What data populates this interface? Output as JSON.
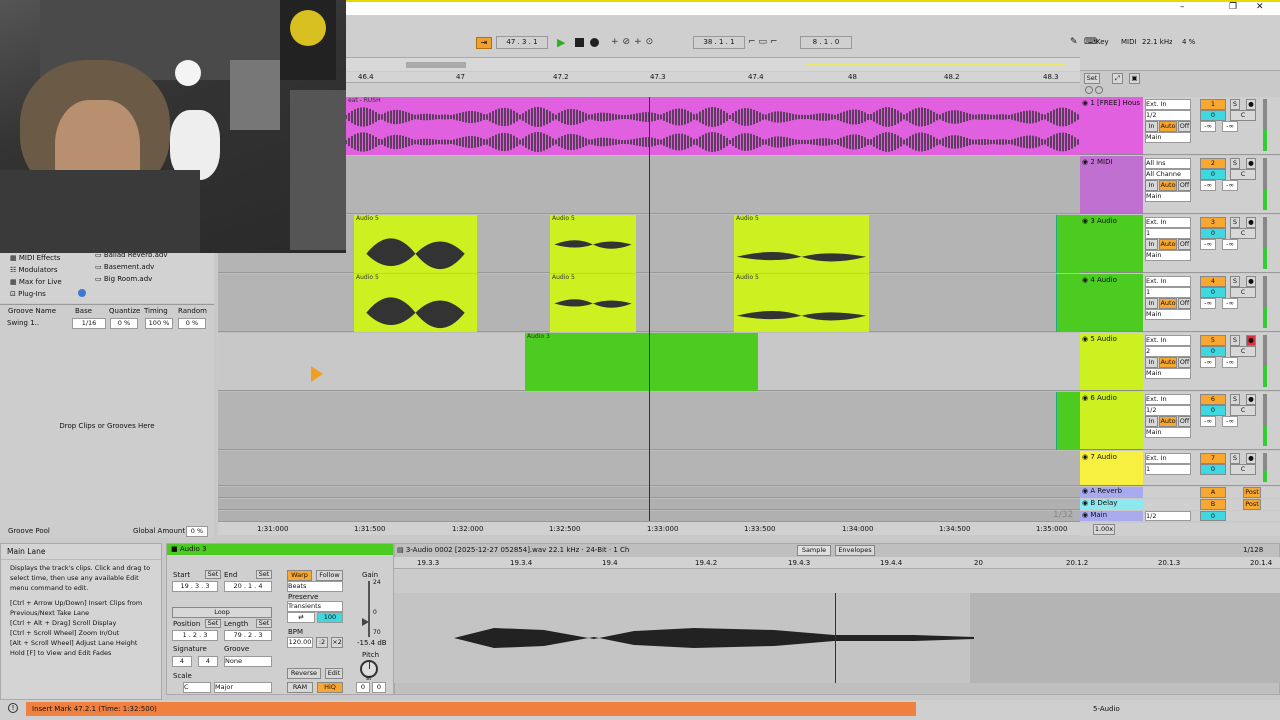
{
  "window": {
    "minimize": "–",
    "restore": "❐",
    "close": "✕"
  },
  "transport": {
    "position": "47 . 3 . 1",
    "loop_start": "38 . 1 . 1",
    "loop_length": "8 . 1 . 0",
    "key_label": "Key",
    "midi_label": "MIDI",
    "sample_rate": "22.1 kHz",
    "cpu": "4 %",
    "icons": [
      "follow-icon",
      "play-icon",
      "stop-icon",
      "record-icon"
    ]
  },
  "ruler": {
    "bars": [
      "46.4",
      "47",
      "47.2",
      "47.3",
      "47.4",
      "48",
      "48.2",
      "48.3"
    ],
    "set_label": "Set",
    "time": [
      "1:31:000",
      "1:31:500",
      "1:32:000",
      "1:32:500",
      "1:33:000",
      "1:33:500",
      "1:34:000",
      "1:34:500",
      "1:35:000"
    ],
    "zoom": "1/32"
  },
  "tracks": [
    {
      "name": "1 [FREE] Hous",
      "clip": "eat - RUSH",
      "input": "Ext. In",
      "channel": "1/2",
      "number": "1",
      "vol": "0",
      "pan": "C",
      "color": "#e060e0"
    },
    {
      "name": "2 MIDI",
      "input": "All Ins",
      "channel": "All Channe",
      "number": "2",
      "vol": "0",
      "pan": "C",
      "color": "#c070d0"
    },
    {
      "name": "3 Audio",
      "clip": "Audio 5",
      "input": "Ext. In",
      "channel": "1",
      "number": "3",
      "vol": "0",
      "pan": "C",
      "color": "#4ccc20"
    },
    {
      "name": "4 Audio",
      "clip": "Audio 5",
      "input": "Ext. In",
      "channel": "1",
      "number": "4",
      "vol": "0",
      "pan": "C",
      "color": "#4ccc20"
    },
    {
      "name": "5 Audio",
      "clip": "Audio 3",
      "input": "Ext. In",
      "channel": "2",
      "number": "5",
      "vol": "0",
      "pan": "C",
      "color": "#ccf020"
    },
    {
      "name": "6 Audio",
      "input": "Ext. In",
      "channel": "1/2",
      "number": "6",
      "vol": "0",
      "pan": "C",
      "color": "#ccf020"
    },
    {
      "name": "7 Audio",
      "input": "Ext. In",
      "channel": "1",
      "number": "7",
      "vol": "0",
      "pan": "C",
      "color": "#f8f040"
    }
  ],
  "returns": [
    {
      "name": "A Reverb",
      "letter": "A",
      "post": "Post"
    },
    {
      "name": "B Delay",
      "letter": "B",
      "post": "Post"
    }
  ],
  "main_track": {
    "name": "Main",
    "channel": "1/2",
    "vol": "0",
    "zoom": "1.00x"
  },
  "io_labels": {
    "in": "In",
    "auto": "Auto",
    "off": "Off",
    "main": "Main",
    "s": "S",
    "inf": "-∞"
  },
  "browser": {
    "items": [
      "MIDI Effects",
      "Modulators",
      "Max for Live",
      "Plug-Ins"
    ],
    "files": [
      "Ballad Reverb.adv",
      "Basement.adv",
      "Big Room.adv"
    ]
  },
  "groove": {
    "headers": [
      "Groove Name",
      "Base",
      "Quantize",
      "Timing",
      "Random"
    ],
    "row": {
      "name": "Swing 1...",
      "base": "1/16",
      "quantize": "0 %",
      "timing": "100 %",
      "random": "0 %"
    },
    "drop": "Drop Clips or Grooves Here",
    "pool": "Groove Pool",
    "global_label": "Global Amount",
    "global": "0 %"
  },
  "info": {
    "title": "Main Lane",
    "text": "Displays the track's clips. Click and drag to select time, then use any available Edit menu command to edit.",
    "shortcuts": [
      "[Ctrl + Arrow Up/Down] Insert Clips from Previous/Next Take Lane",
      "[Ctrl + Alt + Drag] Scroll Display",
      "[Ctrl + Scroll Wheel] Zoom In/Out",
      "[Alt + Scroll Wheel] Adjust Lane Height",
      "Hold [F] to View and Edit Fades"
    ]
  },
  "clip_view": {
    "name": "Audio 3",
    "start_label": "Start",
    "end_label": "End",
    "set": "Set",
    "start": "19 . 3 . 3",
    "end": "20 . 1 . 4",
    "loop": "Loop",
    "position_label": "Position",
    "length_label": "Length",
    "position": "1 . 2 . 3",
    "length": "79 . 2 . 3",
    "signature_label": "Signature",
    "groove_label": "Groove",
    "sig_num": "4",
    "sig_den": "4",
    "groove": "None",
    "scale_label": "Scale",
    "scale_root": "C",
    "scale_mode": "Major",
    "warp": "Warp",
    "follow": "Follow",
    "beats": "Beats",
    "preserve": "Preserve",
    "transients": "Transients",
    "pct": "100",
    "bpm_label": "BPM",
    "bpm": "120.00",
    "half": ":2",
    "double": "×2",
    "reverse": "Reverse",
    "edit": "Edit",
    "ram": "RAM",
    "hiq": "HiQ",
    "gain_label": "Gain",
    "gain": "-15.4 dB",
    "gain_ticks": [
      "24",
      "0",
      "70"
    ],
    "pitch_label": "Pitch",
    "pitch": "0",
    "pitch_fine": "0",
    "st": "st"
  },
  "sample_editor": {
    "file": "3-Audio 0002 [2025-12-27 052854].wav  22.1 kHz · 24-Bit · 1 Ch",
    "tab_sample": "Sample",
    "tab_envelopes": "Envelopes",
    "quant": "1/128",
    "ruler": [
      "19.3.3",
      "19.3.4",
      "19.4",
      "19.4.2",
      "19.4.3",
      "19.4.4",
      "20",
      "20.1.2",
      "20.1.3",
      "20.1.4"
    ]
  },
  "status": {
    "text": "Insert Mark 47.2.1 (Time: 1:32:500)",
    "track": "5-Audio"
  }
}
